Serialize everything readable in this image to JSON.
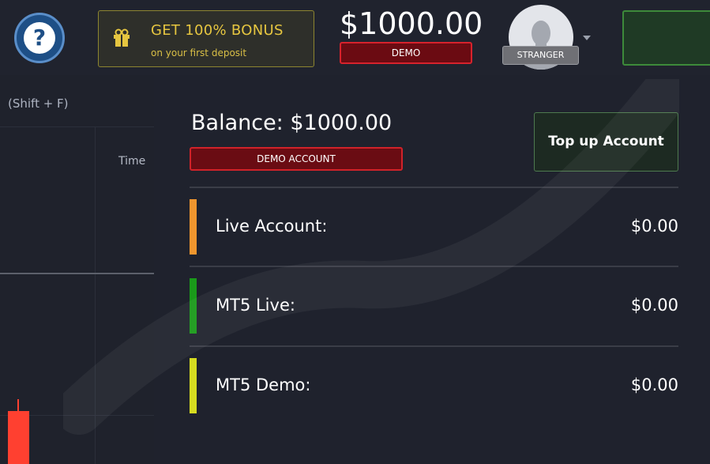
{
  "header": {
    "help_label": "?",
    "bonus": {
      "title": "GET 100% BONUS",
      "subtitle": "on your first deposit",
      "icon": "gift-icon"
    },
    "balance": "$1000.00",
    "demo_badge": "DEMO",
    "user_badge": "STRANGER"
  },
  "chart": {
    "hotkey_hint": "(Shift + F)",
    "time_label": "Time"
  },
  "panel": {
    "balance_title": "Balance: $1000.00",
    "account_type": "DEMO ACCOUNT",
    "topup_label": "Top up Account",
    "accounts": [
      {
        "name": "Live Account:",
        "amount": "$0.00",
        "color": "#f0962e"
      },
      {
        "name": "MT5 Live:",
        "amount": "$0.00",
        "color": "#1a9a1a"
      },
      {
        "name": "MT5 Demo:",
        "amount": "$0.00",
        "color": "#d6dc20"
      }
    ]
  },
  "colors": {
    "accent_demo": "#d7222c",
    "bonus_gold": "#e6c640",
    "topup_border": "#4e7a4f"
  }
}
